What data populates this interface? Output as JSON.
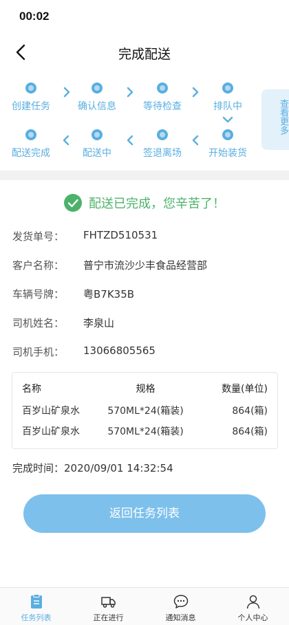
{
  "status_bar": {
    "time": "00:02"
  },
  "nav": {
    "title": "完成配送"
  },
  "steps": [
    {
      "label": "创建任务"
    },
    {
      "label": "确认信息"
    },
    {
      "label": "等待检查"
    },
    {
      "label": "排队中"
    },
    {
      "label": "开始装货"
    },
    {
      "label": "签退离场"
    },
    {
      "label": "配送中"
    },
    {
      "label": "配送完成"
    }
  ],
  "more_tab": {
    "label": "查看更多"
  },
  "success_message": "配送已完成，您辛苦了！",
  "info": [
    {
      "label": "发货单号：",
      "value": "FHTZD510531"
    },
    {
      "label": "客户名称：",
      "value": "普宁市流沙少丰食品经营部"
    },
    {
      "label": "车辆号牌：",
      "value": "粤B7K35B"
    },
    {
      "label": "司机姓名：",
      "value": "李泉山"
    },
    {
      "label": "司机手机：",
      "value": "13066805565"
    }
  ],
  "goods": {
    "headers": {
      "name": "名称",
      "spec": "规格",
      "qty": "数量(单位)"
    },
    "rows": [
      {
        "name": "百岁山矿泉水",
        "spec": "570ML*24(箱装)",
        "qty": "864(箱)"
      },
      {
        "name": "百岁山矿泉水",
        "spec": "570ML*24(箱装)",
        "qty": "864(箱)"
      }
    ]
  },
  "finish_time": {
    "label": "完成时间：",
    "value": "2020/09/01 14:32:54"
  },
  "return_button": "返回任务列表",
  "tabs": [
    {
      "label": "任务列表",
      "active": true
    },
    {
      "label": "正在进行",
      "active": false
    },
    {
      "label": "通知消息",
      "active": false
    },
    {
      "label": "个人中心",
      "active": false
    }
  ],
  "colors": {
    "accent": "#5aaee0",
    "success": "#4cb26a",
    "button": "#7dc0ec"
  }
}
